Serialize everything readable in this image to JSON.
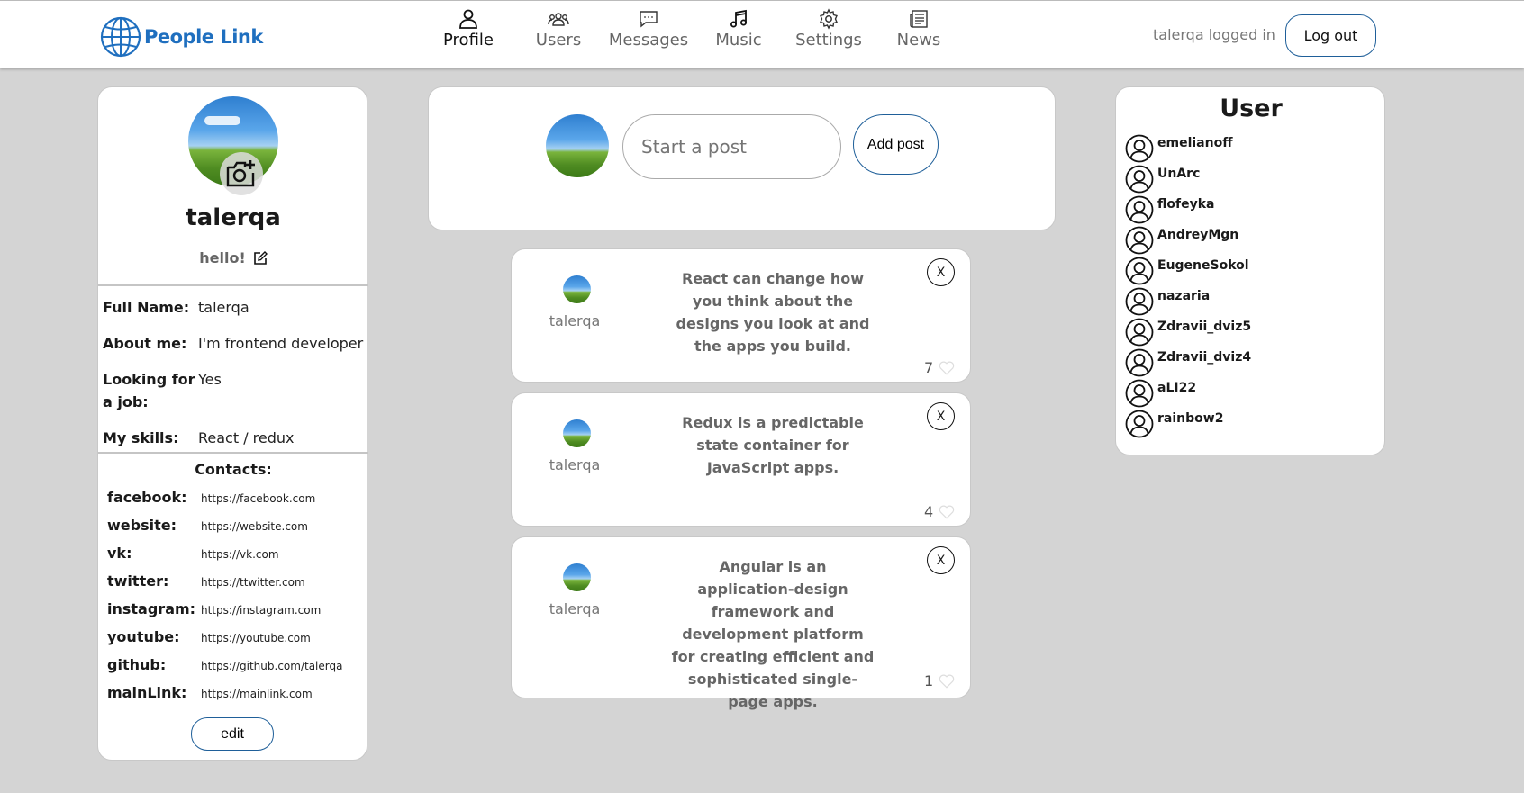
{
  "header": {
    "logo_text": "People Link",
    "nav": [
      {
        "label": "Profile",
        "icon": "person-icon",
        "active": true
      },
      {
        "label": "Users",
        "icon": "users-icon",
        "active": false
      },
      {
        "label": "Messages",
        "icon": "chat-icon",
        "active": false
      },
      {
        "label": "Music",
        "icon": "music-note-icon",
        "active": false
      },
      {
        "label": "Settings",
        "icon": "gear-icon",
        "active": false
      },
      {
        "label": "News",
        "icon": "newspaper-icon",
        "active": false
      }
    ],
    "login_status": "talerqa logged in",
    "logout_label": "Log out"
  },
  "profile": {
    "name": "talerqa",
    "status": "hello!",
    "fields": [
      {
        "label": "Full Name:",
        "value": "talerqa"
      },
      {
        "label": "About me:",
        "value": "I'm frontend developer"
      },
      {
        "label": "Looking for a job:",
        "value": "Yes"
      },
      {
        "label": "My skills:",
        "value": "React / redux"
      }
    ],
    "contacts_title": "Contacts:",
    "contacts": [
      {
        "label": "facebook:",
        "value": "https://facebook.com"
      },
      {
        "label": "website:",
        "value": "https://website.com"
      },
      {
        "label": "vk:",
        "value": "https://vk.com"
      },
      {
        "label": "twitter:",
        "value": "https://ttwitter.com"
      },
      {
        "label": "instagram:",
        "value": "https://instagram.com"
      },
      {
        "label": "youtube:",
        "value": "https://youtube.com"
      },
      {
        "label": "github:",
        "value": "https://github.com/talerqa"
      },
      {
        "label": "mainLink:",
        "value": "https://mainlink.com"
      }
    ],
    "edit_label": "edit"
  },
  "composer": {
    "placeholder": "Start a post",
    "add_label": "Add post"
  },
  "posts": [
    {
      "author": "talerqa",
      "text": "React can change how you think about the designs you look at and the apps you build.",
      "likes": "7",
      "close": "X"
    },
    {
      "author": "talerqa",
      "text": "Redux is a predictable state container for JavaScript apps.",
      "likes": "4",
      "close": "X"
    },
    {
      "author": "talerqa",
      "text": "Angular is an application-design framework and development platform for creating efficient and sophisticated single-page apps.",
      "likes": "1",
      "close": "X"
    }
  ],
  "users": {
    "title": "User",
    "list": [
      "emelianoff",
      "UnArc",
      "flofeyka",
      "AndreyMgn",
      "EugeneSokol",
      "nazaria",
      "Zdravii_dviz5",
      "Zdravii_dviz4",
      "aLI22",
      "rainbow2"
    ]
  },
  "colors": {
    "accent": "#1f6fbf",
    "background": "#d4d4d4",
    "button_border": "#1f5f99"
  }
}
